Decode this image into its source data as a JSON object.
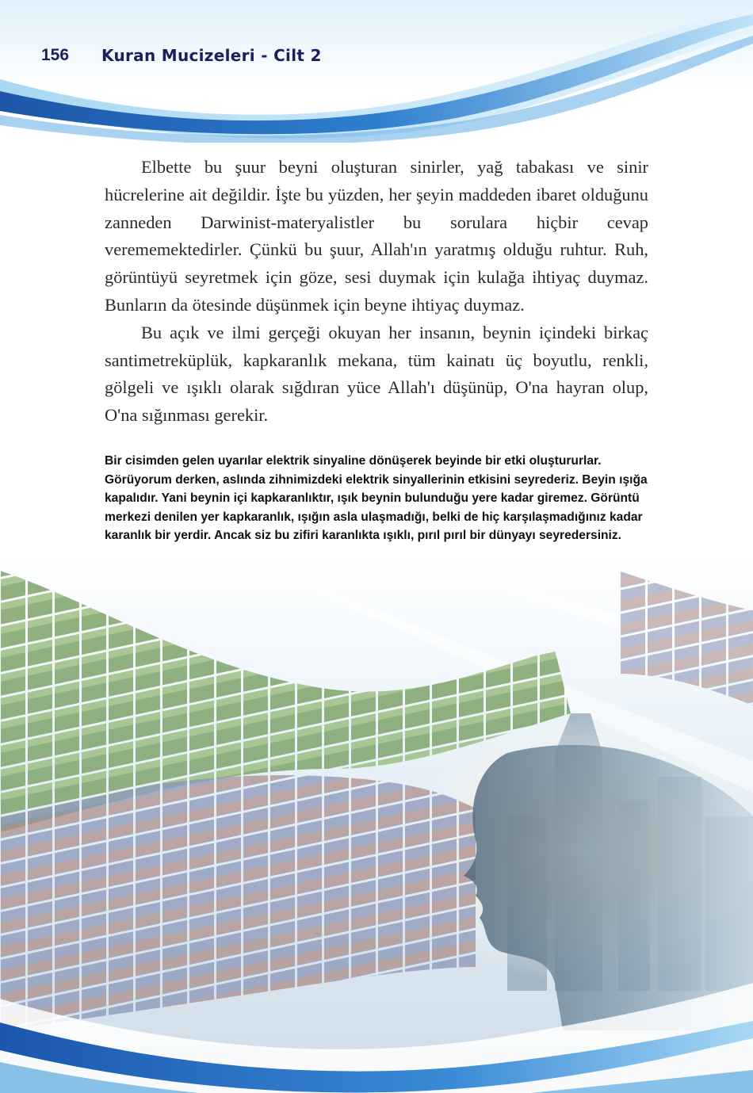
{
  "header": {
    "page_number": "156",
    "running_title": "Kuran Mucizeleri - Cilt 2"
  },
  "body": {
    "paragraphs": [
      "Elbette bu şuur beyni oluşturan sinirler, yağ tabakası ve sinir hücrelerine ait değildir. İşte bu yüzden, her şeyin maddeden ibaret olduğunu zanneden Darwinist-materyalistler bu sorulara hiçbir cevap verememektedirler. Çünkü bu şuur, Allah'ın yaratmış olduğu ruhtur. Ruh, görüntüyü seyretmek için göze, sesi duymak için kulağa ihtiyaç duymaz. Bunların da ötesinde düşünmek için beyne ihtiyaç duymaz.",
      "Bu açık ve ilmi gerçeği okuyan her insanın, beynin içindeki birkaç santimetreküplük, kapkaranlık mekana, tüm kainatı üç boyutlu, renkli, gölgeli ve ışıklı olarak sığdıran yüce Allah'ı düşünüp, O'na hayran olup, O'na sığınması gerekir."
    ]
  },
  "caption": {
    "text": "Bir cisimden gelen uyarılar elektrik sinyaline dönüşerek beyinde bir etki oluştururlar. Görüyorum derken, aslında zihnimizdeki elektrik sinyallerinin etkisini seyrederiz. Beyin ışığa kapalıdır. Yani beynin içi kapkaranlıktır, ışık beynin bulunduğu yere kadar giremez. Görüntü merkezi denilen yer kapkaranlık, ışığın asla ulaşmadığı, belki de hiç karşılaşmadığınız kadar karanlık bir yerdir. Ancak siz bu zifiri karanlıkta ışıklı, pırıl pırıl bir dünyayı seyredersiniz."
  },
  "colors": {
    "title": "#1b1f5c",
    "wave_dark": "#1e5fb0",
    "wave_light": "#8cc7ee",
    "body_text": "#2a2a2a"
  }
}
